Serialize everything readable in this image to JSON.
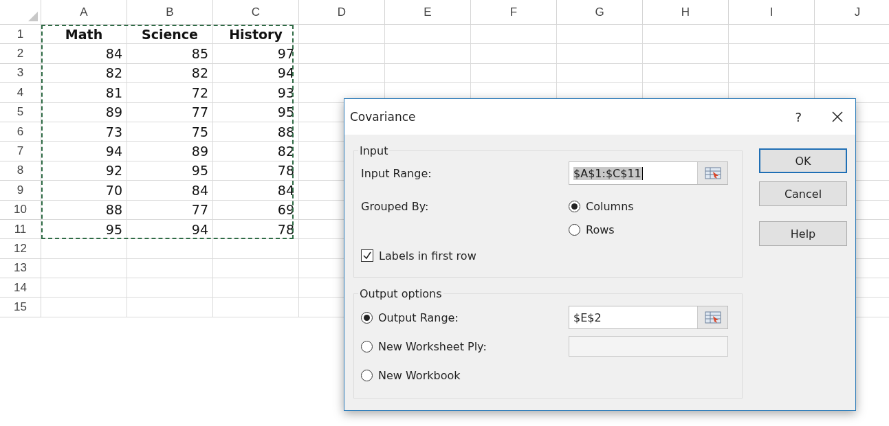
{
  "sheet": {
    "marquee": true,
    "columns": [
      "A",
      "B",
      "C",
      "D",
      "E",
      "F",
      "G",
      "H",
      "I",
      "J"
    ],
    "rows": [
      {
        "header": "1",
        "kind": "heading",
        "cells": [
          "Math",
          "Science",
          "History"
        ]
      },
      {
        "header": "2",
        "kind": "number",
        "cells": [
          "84",
          "85",
          "97"
        ]
      },
      {
        "header": "3",
        "kind": "number",
        "cells": [
          "82",
          "82",
          "94"
        ]
      },
      {
        "header": "4",
        "kind": "number",
        "cells": [
          "81",
          "72",
          "93"
        ]
      },
      {
        "header": "5",
        "kind": "number",
        "cells": [
          "89",
          "77",
          "95"
        ]
      },
      {
        "header": "6",
        "kind": "number",
        "cells": [
          "73",
          "75",
          "88"
        ]
      },
      {
        "header": "7",
        "kind": "number",
        "cells": [
          "94",
          "89",
          "82"
        ]
      },
      {
        "header": "8",
        "kind": "number",
        "cells": [
          "92",
          "95",
          "78"
        ]
      },
      {
        "header": "9",
        "kind": "number",
        "cells": [
          "70",
          "84",
          "84"
        ]
      },
      {
        "header": "10",
        "kind": "number",
        "cells": [
          "88",
          "77",
          "69"
        ]
      },
      {
        "header": "11",
        "kind": "number",
        "cells": [
          "95",
          "94",
          "78"
        ]
      },
      {
        "header": "12",
        "kind": "number"
      },
      {
        "header": "13",
        "kind": "number"
      },
      {
        "header": "14",
        "kind": "number"
      },
      {
        "header": "15",
        "kind": "number"
      }
    ]
  },
  "dialog": {
    "title": "Covariance",
    "help": "?",
    "input": {
      "legend": "Input",
      "range_label": "Input Range:",
      "range_value": "$A$1:$C$11",
      "range_highlighted": true,
      "grouped_label": "Grouped By:",
      "grouped_options": [
        {
          "label": "Columns",
          "selected": true
        },
        {
          "label": "Rows",
          "selected": false
        }
      ],
      "labels_checkbox": {
        "label": "Labels in first row",
        "checked": true
      }
    },
    "output": {
      "legend": "Output options",
      "options": [
        {
          "kind": "range",
          "label": "Output Range:",
          "selected": true,
          "value": "$E$2"
        },
        {
          "kind": "text",
          "label": "New Worksheet Ply:",
          "selected": false
        },
        {
          "kind": "plain",
          "label": "New Workbook",
          "selected": false
        }
      ]
    },
    "buttons": [
      {
        "label": "OK",
        "default": true
      },
      {
        "label": "Cancel",
        "default": false
      },
      {
        "label": "Help",
        "default": false
      }
    ]
  }
}
